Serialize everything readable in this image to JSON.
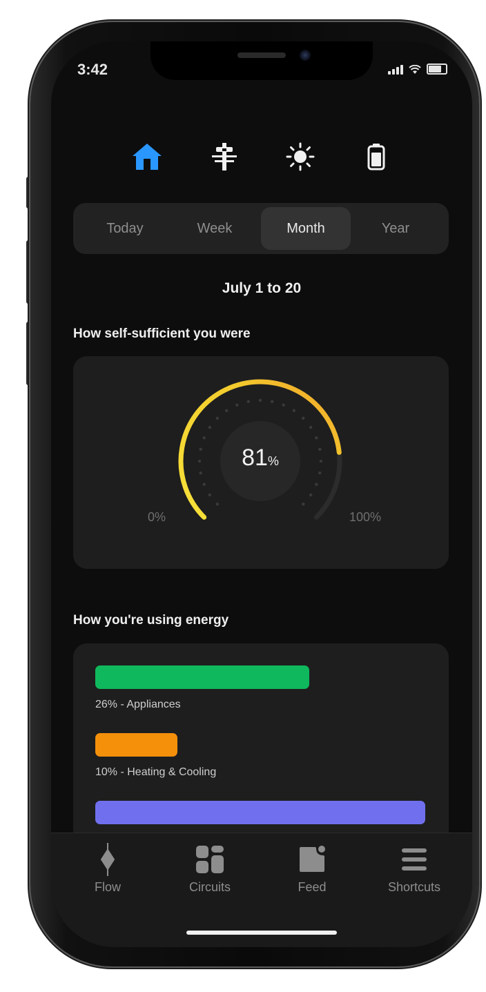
{
  "status_bar": {
    "time": "3:42"
  },
  "top_icons": [
    {
      "name": "home-icon",
      "active": true
    },
    {
      "name": "grid-icon",
      "active": false
    },
    {
      "name": "sun-icon",
      "active": false
    },
    {
      "name": "battery-icon",
      "active": false
    }
  ],
  "period_tabs": [
    {
      "label": "Today",
      "selected": false
    },
    {
      "label": "Week",
      "selected": false
    },
    {
      "label": "Month",
      "selected": true
    },
    {
      "label": "Year",
      "selected": false
    }
  ],
  "date_range": "July 1 to 20",
  "self_sufficiency": {
    "title": "How self-sufficient you were",
    "value": 81,
    "value_text": "81",
    "unit": "%",
    "min_label": "0%",
    "max_label": "100%"
  },
  "energy_usage": {
    "title": "How you're using energy",
    "items": [
      {
        "label": "26% - Appliances",
        "fraction": 0.26,
        "color": "#0fb85c"
      },
      {
        "label": "10% - Heating & Cooling",
        "fraction": 0.1,
        "color": "#f5900b"
      },
      {
        "label": "",
        "fraction": 0.4,
        "color": "#7070ee"
      }
    ]
  },
  "colors": {
    "accent_active": "#2997ff",
    "gauge_start": "#f7e13a",
    "gauge_end": "#f0a12a"
  },
  "bottom_nav": [
    {
      "label": "Flow",
      "icon": "flow-icon"
    },
    {
      "label": "Circuits",
      "icon": "circuits-icon"
    },
    {
      "label": "Feed",
      "icon": "feed-icon"
    },
    {
      "label": "Shortcuts",
      "icon": "shortcuts-icon"
    }
  ]
}
